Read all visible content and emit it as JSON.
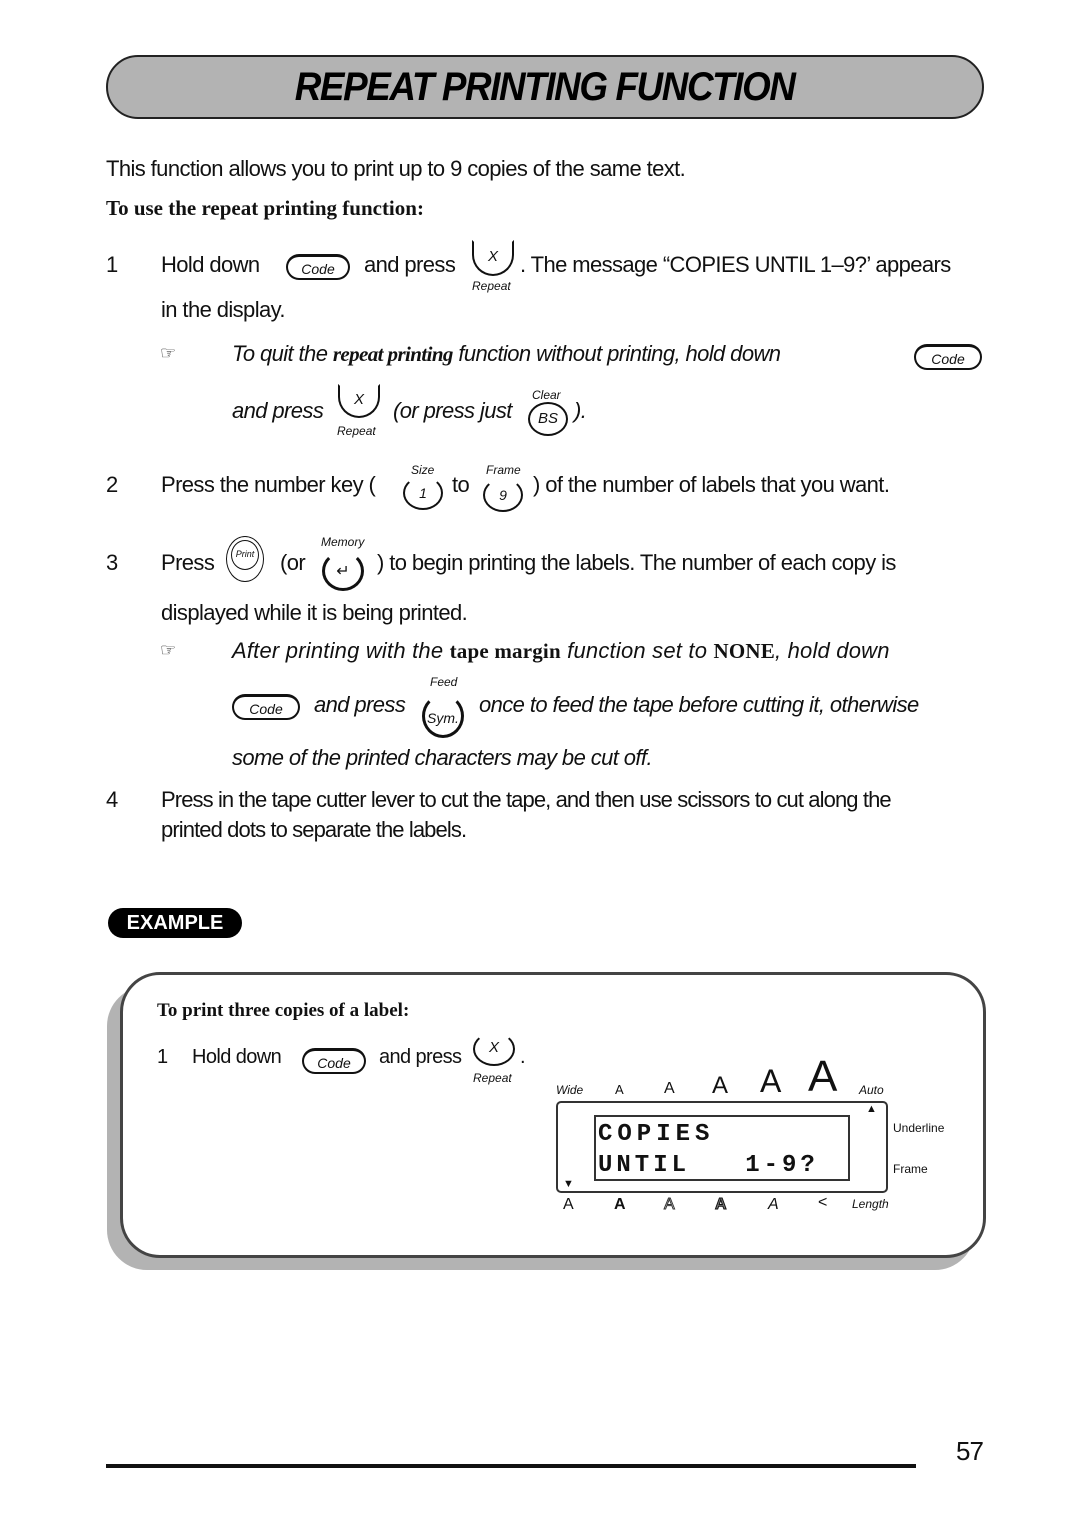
{
  "page_title": "REPEAT PRINTING FUNCTION",
  "intro": "This function allows you to print up to 9 copies of the same text.",
  "subheading": "To use the repeat printing function:",
  "keys": {
    "code": "Code",
    "x": "X",
    "repeat": "Repeat",
    "bs": "BS",
    "clear": "Clear",
    "one": "1",
    "size": "Size",
    "nine": "9",
    "frame": "Frame",
    "print": "Print",
    "memory": "Memory",
    "enter": "↵",
    "sym": "Sym.",
    "feed": "Feed"
  },
  "steps": [
    {
      "num": "1",
      "t1": "Hold down",
      "t2": "and press",
      "t3": ". The message “COPIES UNTIL 1–9?’ appears",
      "t4": "in the display."
    },
    {
      "num": "2",
      "t1": "Press the number key (",
      "t2": "to",
      "t3": ") of the number of labels that you want."
    },
    {
      "num": "3",
      "t1": "Press",
      "t2": "(or",
      "t3": ") to begin printing the labels. The number of each copy is",
      "t4": "displayed while it is being printed."
    },
    {
      "num": "4",
      "line1": "Press in the tape cutter lever to cut the tape, and then use scissors to cut along the",
      "line2": "printed dots to separate the labels."
    }
  ],
  "notes": [
    {
      "icon": "☞",
      "a": "To quit the",
      "b": "repeat printing",
      "c": "function without printing, hold down",
      "d": "and press",
      "e": "(or press just",
      "f": ")."
    },
    {
      "icon": "☞",
      "a": "After printing with the",
      "b": "tape margin",
      "c": "function set to",
      "d": "NONE",
      "e": ", hold down",
      "f": "and press",
      "g": "once to feed the tape before cutting it, otherwise",
      "h": "some of the printed characters may be cut off."
    }
  ],
  "example": {
    "badge": "EXAMPLE",
    "heading": "To print three copies of a label:",
    "step_num": "1",
    "t1": "Hold down",
    "t2": "and press",
    "t3": ".",
    "lcd": {
      "line1": "COPIES",
      "line2": "UNTIL   1-9?",
      "top_labels": [
        "Wide",
        "A",
        "A",
        "A",
        "A",
        "A",
        "Auto"
      ],
      "right_labels": [
        "Underline",
        "Frame"
      ],
      "bottom_labels": [
        "A",
        "A",
        "A",
        "A",
        "A",
        "<",
        "Length"
      ],
      "up_arrow": "▲",
      "down_arrow": "▼"
    }
  },
  "page_number": "57"
}
